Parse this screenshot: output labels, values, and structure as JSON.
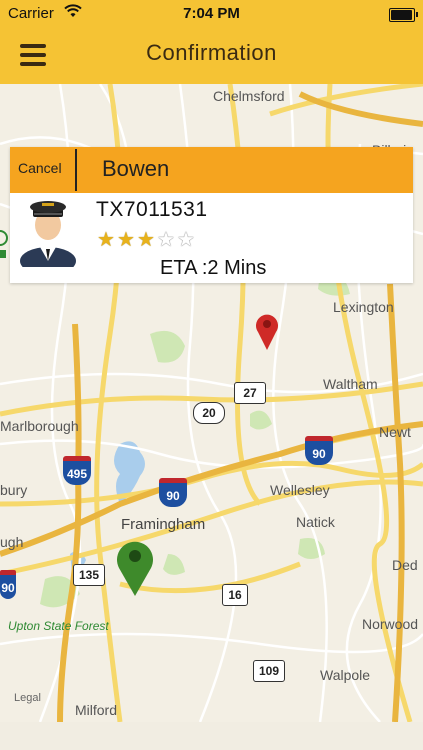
{
  "status_bar": {
    "carrier": "Carrier",
    "time": "7:04 PM",
    "battery_level": 0.95
  },
  "nav": {
    "title": "Confirmation"
  },
  "driver_card": {
    "cancel_label": "Cancel",
    "driver_name": "Bowen",
    "vehicle_id": "TX7011531",
    "rating": 3,
    "rating_max": 5,
    "eta_label": "ETA :2  Mins"
  },
  "map": {
    "places": {
      "chelmsford": "Chelmsford",
      "billerica": "Billeric",
      "lexington": "Lexington",
      "waltham": "Waltham",
      "newton": "Newt",
      "marlborough": "Marlborough",
      "wellesley": "Wellesley",
      "framingham": "Framingham",
      "natick": "Natick",
      "sudbury_partial": "bury",
      "hopkinton_partial": "ugh",
      "dedham_partial": "Ded",
      "norwood": "Norwood",
      "upton": "Upton State Forest",
      "walpole": "Walpole",
      "milford": "Milford",
      "legal": "Legal"
    },
    "shields": {
      "r27": "27",
      "r20": "20",
      "i495": "495",
      "i90a": "90",
      "i90b": "90",
      "i90c": "90",
      "r135": "135",
      "r16": "16",
      "r109": "109"
    },
    "pins": {
      "pickup_color": "#cf2a27",
      "driver_color": "#3e8a2b"
    }
  },
  "colors": {
    "accent_yellow": "#f5c334",
    "header_orange": "#f5a41f"
  }
}
